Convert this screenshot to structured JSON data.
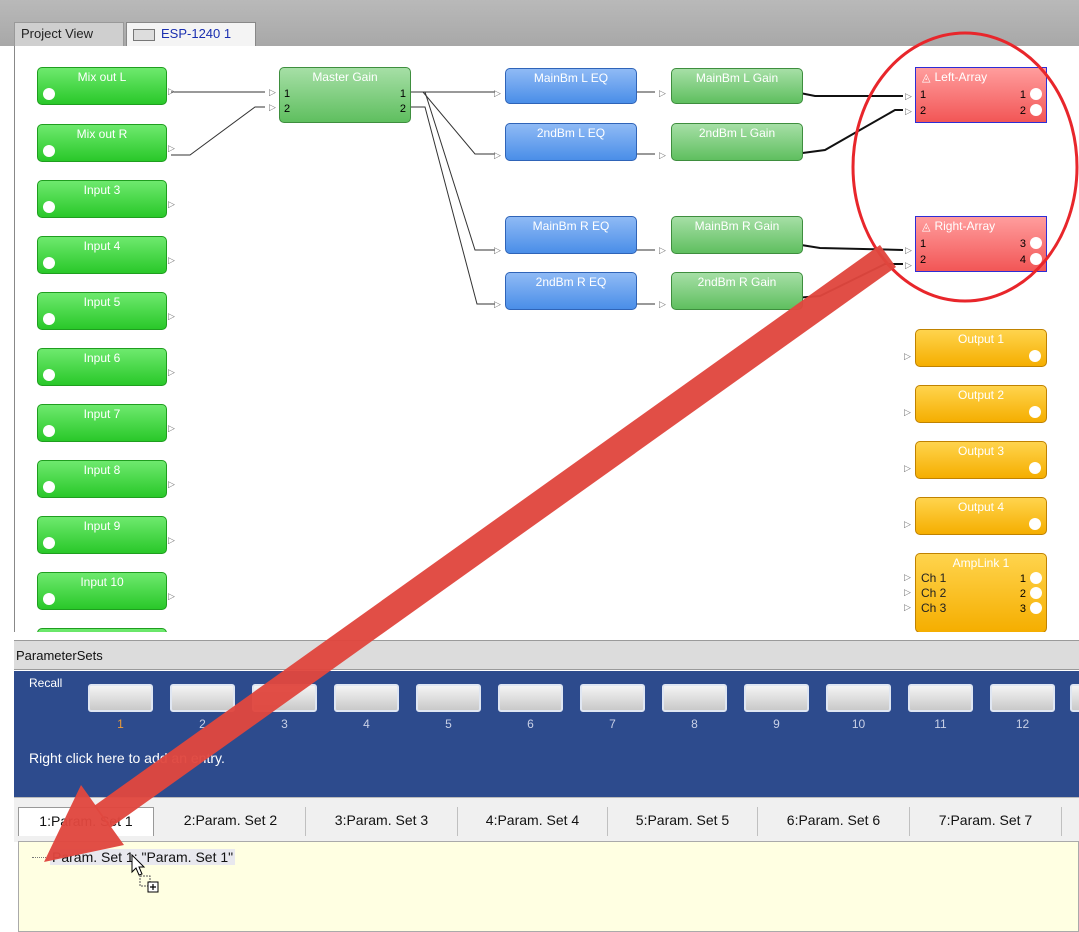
{
  "tabs": {
    "project": "Project View",
    "esp": "ESP-1240 1"
  },
  "inputs": [
    {
      "label": "Mix out L"
    },
    {
      "label": "Mix out R"
    },
    {
      "label": "Input 3"
    },
    {
      "label": "Input 4"
    },
    {
      "label": "Input 5"
    },
    {
      "label": "Input 6"
    },
    {
      "label": "Input 7"
    },
    {
      "label": "Input 8"
    },
    {
      "label": "Input 9"
    },
    {
      "label": "Input 10"
    }
  ],
  "master_gain": {
    "label": "Master Gain",
    "in1": "1",
    "in2": "2",
    "out1": "1",
    "out2": "2"
  },
  "eq_blocks": [
    {
      "label": "MainBm L EQ"
    },
    {
      "label": "2ndBm L EQ"
    },
    {
      "label": "MainBm R EQ"
    },
    {
      "label": "2ndBm R EQ"
    }
  ],
  "gain_blocks": [
    {
      "label": "MainBm L Gain"
    },
    {
      "label": "2ndBm L Gain"
    },
    {
      "label": "MainBm R Gain"
    },
    {
      "label": "2ndBm R Gain"
    }
  ],
  "arrays": [
    {
      "label": "Left-Array",
      "in1": "1",
      "in2": "2",
      "out1": "1",
      "out2": "2"
    },
    {
      "label": "Right-Array",
      "in1": "1",
      "in2": "2",
      "out1": "3",
      "out2": "4"
    }
  ],
  "outputs": [
    {
      "label": "Output 1"
    },
    {
      "label": "Output 2"
    },
    {
      "label": "Output 3"
    },
    {
      "label": "Output 4"
    }
  ],
  "amplink": {
    "label": "AmpLink 1",
    "channels": [
      {
        "name": "Ch 1",
        "num": "1"
      },
      {
        "name": "Ch 2",
        "num": "2"
      },
      {
        "name": "Ch 3",
        "num": "3"
      }
    ]
  },
  "parameter_sets": {
    "title": "ParameterSets",
    "recall_label": "Recall",
    "numbers": [
      "1",
      "2",
      "3",
      "4",
      "5",
      "6",
      "7",
      "8",
      "9",
      "10",
      "11",
      "12"
    ],
    "hint": "Right click here to add an entry.",
    "tabs": [
      "1:Param. Set 1",
      "2:Param. Set 2",
      "3:Param. Set 3",
      "4:Param. Set 4",
      "5:Param. Set 5",
      "6:Param. Set 6",
      "7:Param. Set 7"
    ],
    "tree_item": "Param. Set 1: \"Param. Set 1\""
  },
  "colors": {
    "highlight_circle": "#e8262b",
    "drag_arrow": "#e0473e",
    "recall_panel": "#2d4b8d"
  }
}
